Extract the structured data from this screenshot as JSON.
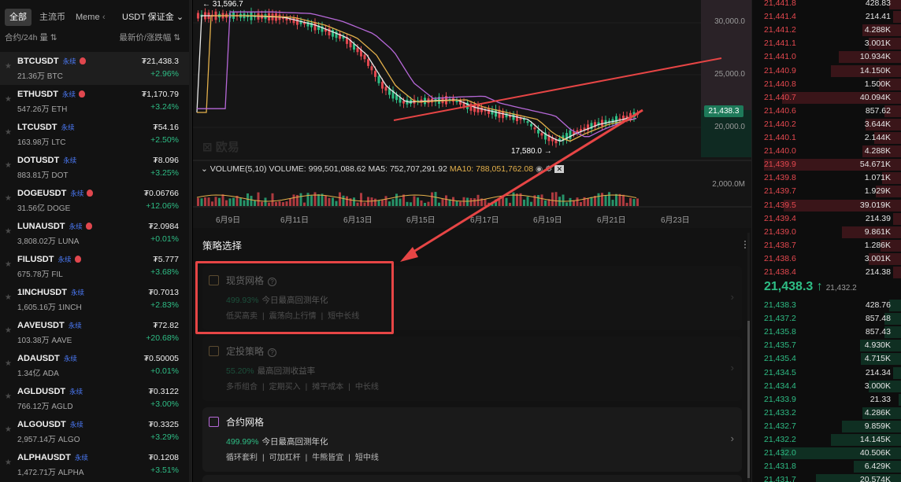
{
  "left_panel": {
    "tabs": [
      "全部",
      "主流币",
      "Meme",
      "USDT 保证金 ⌄"
    ],
    "header_left": "合约/24h 量 ⇅",
    "header_right": "最新价/涨跌幅 ⇅",
    "rows": [
      {
        "symbol": "BTCUSDT",
        "tag": "永续",
        "hot": true,
        "vol": "21.36万 BTC",
        "price": "₮21,438.3",
        "change": "+2.96%"
      },
      {
        "symbol": "ETHUSDT",
        "tag": "永续",
        "hot": true,
        "vol": "547.26万 ETH",
        "price": "₮1,170.79",
        "change": "+3.24%"
      },
      {
        "symbol": "LTCUSDT",
        "tag": "永续",
        "hot": false,
        "vol": "163.98万 LTC",
        "price": "₮54.16",
        "change": "+2.50%"
      },
      {
        "symbol": "DOTUSDT",
        "tag": "永续",
        "hot": false,
        "vol": "883.81万 DOT",
        "price": "₮8.096",
        "change": "+3.25%"
      },
      {
        "symbol": "DOGEUSDT",
        "tag": "永续",
        "hot": true,
        "vol": "31.56亿 DOGE",
        "price": "₮0.06766",
        "change": "+12.06%"
      },
      {
        "symbol": "LUNAUSDT",
        "tag": "永续",
        "hot": true,
        "vol": "3,808.02万 LUNA",
        "price": "₮2.0984",
        "change": "+0.01%"
      },
      {
        "symbol": "FILUSDT",
        "tag": "永续",
        "hot": true,
        "vol": "675.78万 FIL",
        "price": "₮5.777",
        "change": "+3.68%"
      },
      {
        "symbol": "1INCHUSDT",
        "tag": "永续",
        "hot": false,
        "vol": "1,605.16万 1INCH",
        "price": "₮0.7013",
        "change": "+2.83%"
      },
      {
        "symbol": "AAVEUSDT",
        "tag": "永续",
        "hot": false,
        "vol": "103.38万 AAVE",
        "price": "₮72.82",
        "change": "+20.68%"
      },
      {
        "symbol": "ADAUSDT",
        "tag": "永续",
        "hot": false,
        "vol": "1.34亿 ADA",
        "price": "₮0.50005",
        "change": "+0.01%"
      },
      {
        "symbol": "AGLDUSDT",
        "tag": "永续",
        "hot": false,
        "vol": "766.12万 AGLD",
        "price": "₮0.3122",
        "change": "+3.00%"
      },
      {
        "symbol": "ALGOUSDT",
        "tag": "永续",
        "hot": false,
        "vol": "2,957.14万 ALGO",
        "price": "₮0.3325",
        "change": "+3.29%"
      },
      {
        "symbol": "ALPHAUSDT",
        "tag": "永续",
        "hot": false,
        "vol": "1,472.71万 ALPHA",
        "price": "₮0.1208",
        "change": "+3.51%"
      }
    ]
  },
  "chart": {
    "high_label": "← 31,596.7",
    "low_label": "17,580.0 →",
    "y_ticks": [
      "30,000.0",
      "25,000.0",
      "20,000.0",
      "2,000.0M"
    ],
    "x_ticks": [
      "6月9日",
      "6月11日",
      "6月13日",
      "6月15日",
      "6月17日",
      "6月19日",
      "6月21日",
      "6月23日"
    ],
    "last_price": "21,438.3",
    "watermark": "欧易",
    "volume_label": "VOLUME(5,10)",
    "volume_value": "VOLUME: 999,501,088.62",
    "ma5": "MA5: 752,707,291.92",
    "ma10": "MA10: 788,051,762.08"
  },
  "strategy": {
    "title": "策略选择",
    "cards": [
      {
        "name": "现货网格",
        "pct": "499.93%",
        "pct_text": "今日最高回测年化",
        "tags": [
          "低买高卖",
          "震荡向上行情",
          "短中长线"
        ],
        "dim": true
      },
      {
        "name": "定投策略",
        "pct": "55.20%",
        "pct_text": "最高回测收益率",
        "tags": [
          "多币组合",
          "定期买入",
          "摊平成本",
          "中长线"
        ],
        "dim": true
      },
      {
        "name": "合约网格",
        "pct": "499.99%",
        "pct_text": "今日最高回测年化",
        "tags": [
          "循环套利",
          "可加杠杆",
          "牛熊皆宜",
          "短中线"
        ],
        "dim": false
      }
    ]
  },
  "orderbook": {
    "asks": [
      [
        "21,441.8",
        "428.83"
      ],
      [
        "21,441.4",
        "214.41"
      ],
      [
        "21,441.2",
        "4.288K"
      ],
      [
        "21,441.1",
        "3.001K"
      ],
      [
        "21,441.0",
        "10.934K"
      ],
      [
        "21,440.9",
        "14.150K"
      ],
      [
        "21,440.8",
        "1.500K"
      ],
      [
        "21,440.7",
        "40.094K"
      ],
      [
        "21,440.6",
        "857.62"
      ],
      [
        "21,440.2",
        "3.644K"
      ],
      [
        "21,440.1",
        "2.144K"
      ],
      [
        "21,440.0",
        "4.288K"
      ],
      [
        "21,439.9",
        "54.671K"
      ],
      [
        "21,439.8",
        "1.071K"
      ],
      [
        "21,439.7",
        "1.929K"
      ],
      [
        "21,439.5",
        "39.019K"
      ],
      [
        "21,439.4",
        "214.39"
      ],
      [
        "21,439.0",
        "9.861K"
      ],
      [
        "21,438.7",
        "1.286K"
      ],
      [
        "21,438.6",
        "3.001K"
      ],
      [
        "21,438.4",
        "214.38"
      ]
    ],
    "mid_price": "21,438.3 ↑",
    "mid_sub": "21,432.2",
    "bids": [
      [
        "21,438.3",
        "428.76"
      ],
      [
        "21,437.2",
        "857.48"
      ],
      [
        "21,435.8",
        "857.43"
      ],
      [
        "21,435.7",
        "4.930K"
      ],
      [
        "21,435.4",
        "4.715K"
      ],
      [
        "21,434.5",
        "214.34"
      ],
      [
        "21,434.4",
        "3.000K"
      ],
      [
        "21,433.9",
        "21.33"
      ],
      [
        "21,433.2",
        "4.286K"
      ],
      [
        "21,432.7",
        "9.859K"
      ],
      [
        "21,432.2",
        "14.145K"
      ],
      [
        "21,432.0",
        "40.506K"
      ],
      [
        "21,431.8",
        "6.429K"
      ],
      [
        "21,431.7",
        "20.574K"
      ]
    ]
  }
}
